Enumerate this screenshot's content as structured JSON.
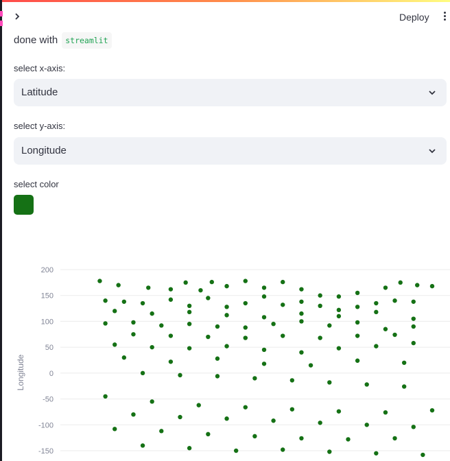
{
  "colors": {
    "accent": "#157115",
    "select_bg": "#f0f2f6"
  },
  "header": {
    "deploy_label": "Deploy",
    "sidebar_toggle_icon": "chevron-right-icon",
    "menu_icon": "kebab-menu-icon"
  },
  "intro": {
    "text": "done with",
    "code": "streamlit"
  },
  "x_select": {
    "label": "select x-axis:",
    "value": "Latitude"
  },
  "y_select": {
    "label": "select y-axis:",
    "value": "Longitude"
  },
  "color_picker": {
    "label": "select color",
    "value": "#157115"
  },
  "chart_data": {
    "type": "scatter",
    "ylabel": "Longitude",
    "xlabel": "",
    "ylim": [
      -160,
      200
    ],
    "yticks": [
      200,
      150,
      100,
      50,
      0,
      -50,
      -100,
      -150
    ],
    "grid": true,
    "color": "#157115",
    "x": [
      -98,
      -88,
      -72,
      -60,
      -52,
      -44,
      -38,
      -30,
      -20,
      -10,
      0,
      10,
      20,
      30,
      40,
      55,
      63,
      72,
      80,
      -95,
      -85,
      -75,
      -60,
      -50,
      -40,
      -30,
      -20,
      -10,
      0,
      10,
      20,
      30,
      40,
      50,
      60,
      70,
      -90,
      -70,
      -50,
      -30,
      -10,
      10,
      30,
      50,
      70,
      -95,
      -80,
      -65,
      -50,
      -35,
      -20,
      -5,
      10,
      25,
      40,
      55,
      70,
      -80,
      -60,
      -40,
      -20,
      0,
      20,
      40,
      60,
      -90,
      -70,
      -50,
      -30,
      -10,
      10,
      30,
      50,
      70,
      -85,
      -60,
      -35,
      -10,
      15,
      40,
      65,
      -75,
      -55,
      -35,
      -15,
      5,
      25,
      45,
      65,
      -95,
      -70,
      -45,
      -20,
      5,
      30,
      55,
      80,
      -80,
      -55,
      -30,
      -5,
      20,
      45,
      70,
      -90,
      -65,
      -40,
      -15,
      10,
      35,
      60,
      -75,
      -50,
      -25,
      0,
      25,
      50,
      75
    ],
    "y": [
      178,
      170,
      165,
      162,
      175,
      160,
      176,
      168,
      178,
      165,
      176,
      162,
      150,
      148,
      155,
      165,
      175,
      170,
      168,
      140,
      138,
      135,
      142,
      130,
      145,
      128,
      135,
      148,
      132,
      138,
      130,
      122,
      128,
      135,
      140,
      138,
      120,
      115,
      118,
      112,
      108,
      115,
      110,
      118,
      105,
      96,
      98,
      92,
      95,
      90,
      88,
      95,
      100,
      92,
      98,
      85,
      90,
      75,
      72,
      70,
      68,
      72,
      68,
      72,
      74,
      55,
      50,
      48,
      52,
      45,
      40,
      48,
      52,
      58,
      30,
      22,
      28,
      18,
      15,
      24,
      20,
      0,
      -4,
      -6,
      -10,
      -14,
      -18,
      -22,
      -26,
      -45,
      -55,
      -62,
      -66,
      -70,
      -74,
      -76,
      -72,
      -80,
      -85,
      -88,
      -92,
      -96,
      -100,
      -104,
      -108,
      -112,
      -118,
      -122,
      -126,
      -128,
      -126,
      -140,
      -145,
      -150,
      -148,
      -152,
      -155,
      -158
    ]
  }
}
